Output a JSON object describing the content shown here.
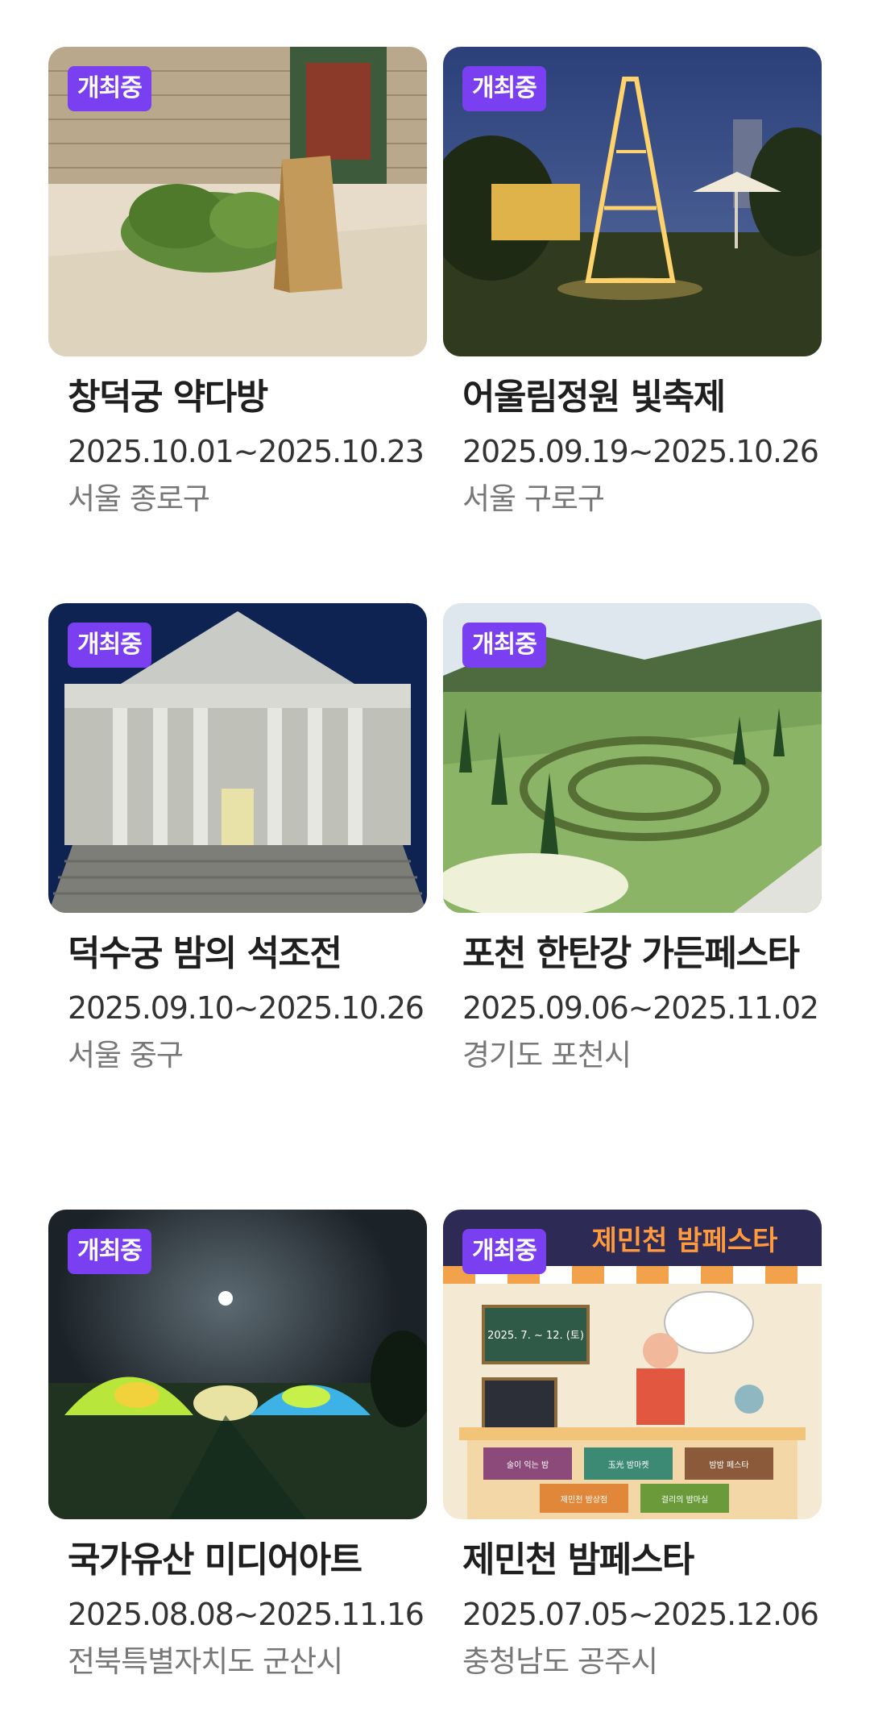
{
  "badge_label": "개최중",
  "festivals": [
    {
      "title": "창덕궁 약다방",
      "period": "2025.10.01~2025.10.23",
      "region": "서울 종로구"
    },
    {
      "title": "어울림정원 빛축제",
      "period": "2025.09.19~2025.10.26",
      "region": "서울 구로구"
    },
    {
      "title": "덕수궁 밤의 석조전",
      "period": "2025.09.10~2025.10.26",
      "region": "서울 중구"
    },
    {
      "title": "포천 한탄강 가든페스타",
      "period": "2025.09.06~2025.11.02",
      "region": "경기도 포천시"
    },
    {
      "title": "국가유산 미디어아트",
      "period": "2025.08.08~2025.11.16",
      "region": "전북특별자치도 군산시"
    },
    {
      "title": "제민천 밤페스타",
      "period": "2025.07.05~2025.12.06",
      "region": "충청남도 공주시"
    }
  ],
  "poster": {
    "headline": "제민천 밤페스타",
    "chalkboard": "2025. 7. ~ 12. (토)",
    "stalls": [
      "술이 익는 밤",
      "玉光 밤마켓",
      "밤밤 페스타",
      "제민천 밤상점",
      "걸리의 밤마실"
    ]
  },
  "colors": {
    "badge": "#7b3ff2",
    "title": "#1f1f1f",
    "period": "#333333",
    "region": "#777777"
  }
}
